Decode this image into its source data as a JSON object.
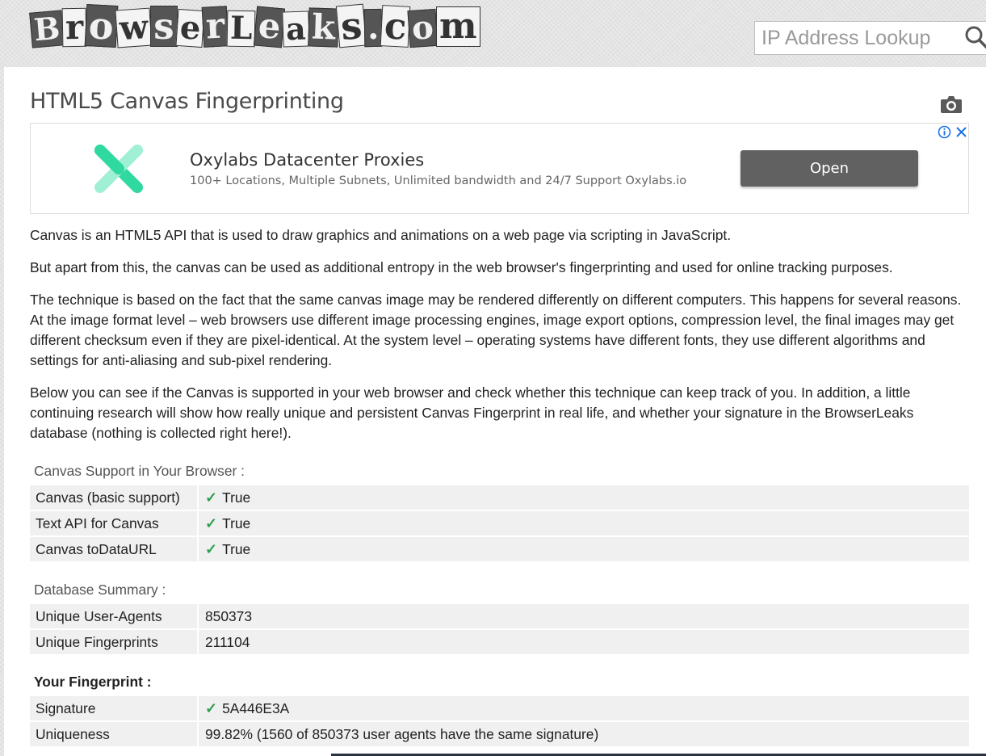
{
  "header": {
    "logo_letters": [
      "B",
      "r",
      "o",
      "w",
      "s",
      "e",
      "r",
      "L",
      "e",
      "a",
      "k",
      "s",
      ".",
      "c",
      "o",
      "m"
    ],
    "search_placeholder": "IP Address Lookup"
  },
  "page": {
    "title": "HTML5 Canvas Fingerprinting"
  },
  "ad": {
    "title": "Oxylabs Datacenter Proxies",
    "description": "100+ Locations, Multiple Subnets, Unlimited bandwidth and 24/7 Support Oxylabs.io",
    "button_label": "Open",
    "logo_color": "#2fd9a0"
  },
  "intro": {
    "p1": "Canvas is an HTML5 API that is used to draw graphics and animations on a web page via scripting in JavaScript.",
    "p2": "But apart from this, the canvas can be used as additional entropy in the web browser's fingerprinting and used for online tracking purposes.",
    "p3": "The technique is based on the fact that the same canvas image may be rendered differently on different computers. This happens for several reasons. At the image format level – web browsers use different image processing engines, image export options, compression level, the final images may get different checksum even if they are pixel-identical. At the system level – operating systems have different fonts, they use different algorithms and settings for anti-aliasing and sub-pixel rendering.",
    "p4": "Below you can see if the Canvas is supported in your web browser and check whether this technique can keep track of you. In addition, a little continuing research will show how really unique and persistent Canvas Fingerprint in real life, and whether your signature in the BrowserLeaks database (nothing is collected right here!)."
  },
  "support": {
    "label": "Canvas Support in Your Browser :",
    "rows": [
      {
        "key": "Canvas (basic support)",
        "value": "True"
      },
      {
        "key": "Text API for Canvas",
        "value": "True"
      },
      {
        "key": "Canvas toDataURL",
        "value": "True"
      }
    ]
  },
  "database": {
    "label": "Database Summary :",
    "rows": [
      {
        "key": "Unique User-Agents",
        "value": "850373"
      },
      {
        "key": "Unique Fingerprints",
        "value": "211104"
      }
    ]
  },
  "fingerprint": {
    "label": "Your Fingerprint :",
    "rows": [
      {
        "key": "Signature",
        "value": "5A446E3A"
      },
      {
        "key": "Uniqueness",
        "value": "99.82% (1560 of 850373 user agents have the same signature)"
      }
    ]
  },
  "colors": {
    "check": "#2e9e4e",
    "row_bg": "#f0f0f0",
    "button_bg": "#616161"
  }
}
